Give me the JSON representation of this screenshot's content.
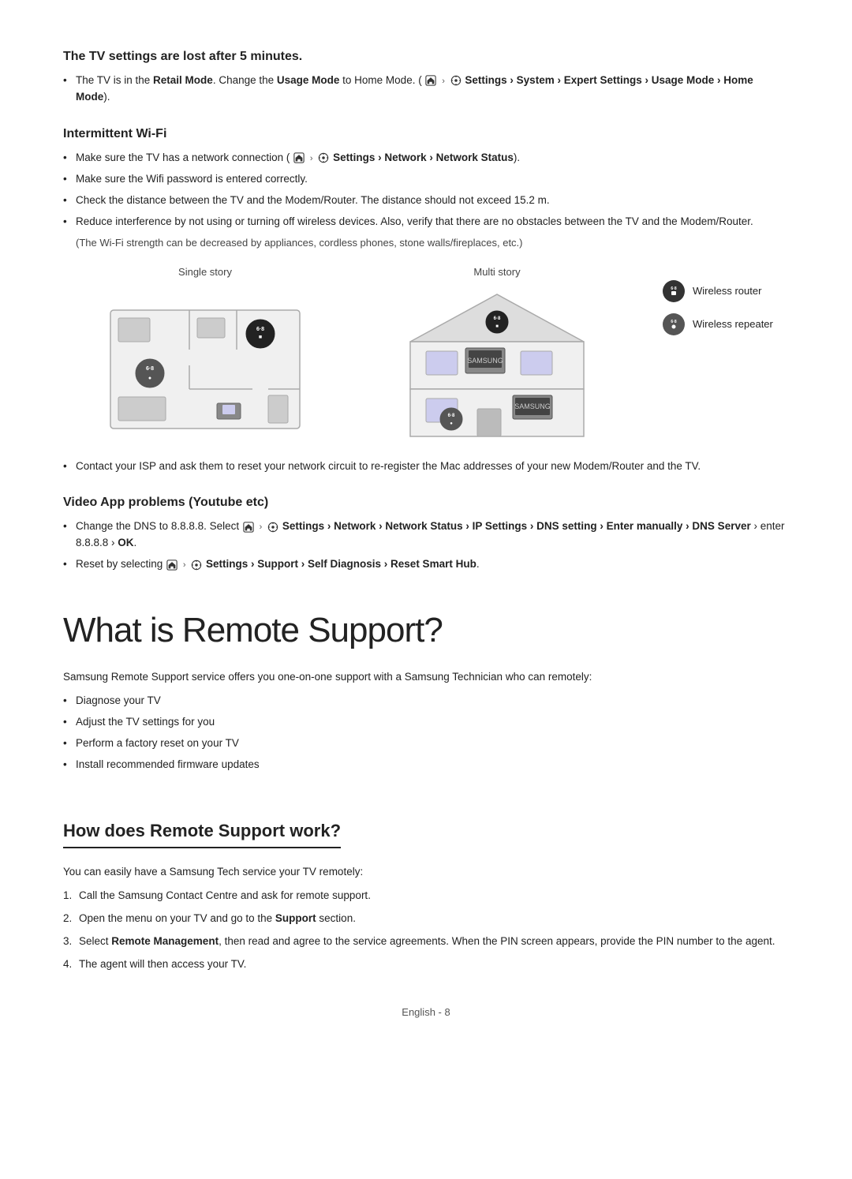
{
  "sections": {
    "tv_settings_lost": {
      "title": "The TV settings are lost after 5 minutes.",
      "bullets": [
        {
          "text": "The TV is in the ",
          "parts": [
            {
              "text": "Retail Mode",
              "bold": true
            },
            {
              "text": ". Change the "
            },
            {
              "text": "Usage Mode",
              "bold": true
            },
            {
              "text": " to Home Mode. ("
            },
            {
              "text": "home_icon",
              "icon": "home"
            },
            {
              "text": " > "
            },
            {
              "text": "settings_icon",
              "icon": "settings"
            },
            {
              "text": " Settings > System > Expert Settings > Usage Mode > Home Mode",
              "bold": true
            },
            {
              "text": ")."
            }
          ]
        }
      ]
    },
    "intermittent_wifi": {
      "title": "Intermittent Wi-Fi",
      "bullets": [
        "Make sure the TV has a network connection (__home__ > __settings__ Settings > Network > Network Status).",
        "Make sure the Wifi password is entered correctly.",
        "Check the distance between the TV and the Modem/Router. The distance should not exceed 15.2 m.",
        "Reduce interference by not using or turning off wireless devices. Also, verify that there are no obstacles between the TV and the Modem/Router.",
        "(The Wi-Fi strength can be decreased by appliances, cordless phones, stone walls/fireplaces, etc.)"
      ],
      "diagram": {
        "single_story_label": "Single story",
        "multi_story_label": "Multi story",
        "wireless_router_label": "Wireless router",
        "wireless_repeater_label": "Wireless repeater"
      },
      "contact_text": "Contact your ISP and ask them to reset your network circuit to re-register the Mac addresses of your new Modem/Router and the TV."
    },
    "video_app_problems": {
      "title": "Video App problems (Youtube etc)",
      "bullet1_pre": "Change the DNS to 8.8.8.8. Select ",
      "bullet1_bold1": "Settings",
      "bullet1_nav": " > Network > Network Status > IP Settings > DNS setting > Enter manually > DNS Server",
      "bullet1_post": " > enter 8.8.8.8 > OK.",
      "bullet2_pre": "Reset by selecting ",
      "bullet2_nav": " Settings > Support > Self Diagnosis > Reset Smart Hub",
      "bullet2_post": "."
    },
    "what_is_remote_support": {
      "title": "What is Remote Support?",
      "intro": "Samsung Remote Support service offers you one-on-one support with a Samsung Technician who can remotely:",
      "bullets": [
        "Diagnose your TV",
        "Adjust the TV settings for you",
        "Perform a factory reset on your TV",
        "Install recommended firmware updates"
      ]
    },
    "how_does_remote_support": {
      "title": "How does Remote Support work?",
      "intro": "You can easily have a Samsung Tech service your TV remotely:",
      "steps": [
        "Call the Samsung Contact Centre and ask for remote support.",
        "Open the menu on your TV and go to the __Support__ section.",
        "Select __Remote Management__, then read and agree to the service agreements. When the PIN screen appears, provide the PIN number to the agent.",
        "The agent will then access your TV."
      ]
    }
  },
  "footer": {
    "text": "English - 8"
  },
  "icons": {
    "home": "⌂",
    "settings": "⚙",
    "chevron": "›"
  }
}
